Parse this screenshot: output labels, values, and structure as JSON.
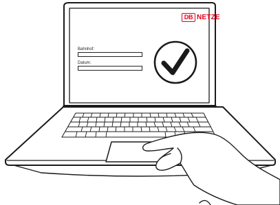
{
  "brand": {
    "logo_text": "DB",
    "name": "NETZE",
    "color": "#e2001a"
  },
  "form": {
    "fields": [
      {
        "label": "Bahnhof:",
        "value": ""
      },
      {
        "label": "Datum:",
        "value": ""
      }
    ]
  },
  "icons": {
    "status": "checkmark-circle-icon",
    "device": "laptop-icon",
    "hand": "hand-icon"
  }
}
